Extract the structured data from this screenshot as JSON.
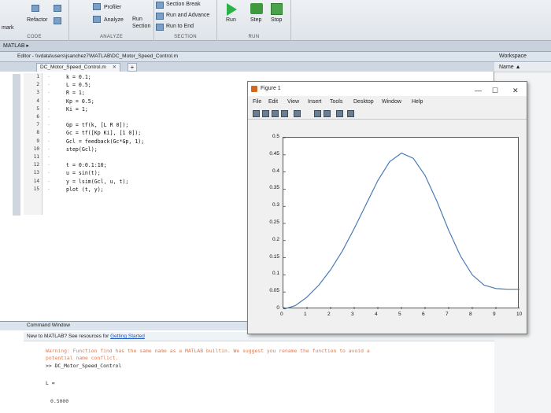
{
  "ribbon": {
    "refactor_label": "Refactor",
    "profiler_label": "Profiler",
    "analyze_label": "Analyze",
    "run_section_label": "Run\nSection",
    "section_break_label": "Section Break",
    "run_and_advance_label": "Run and Advance",
    "run_to_end_label": "Run to End",
    "run_label": "Run",
    "step_label": "Step",
    "stop_label": "Stop",
    "groups": {
      "code": "CODE",
      "analyze": "ANALYZE",
      "section": "SECTION",
      "run": "RUN"
    },
    "bookmark_label": "mark"
  },
  "matlab_bar": {
    "title": "MATLAB ▸"
  },
  "editor": {
    "title": "Editor - \\\\vdata\\users\\jsanchez7\\MATLAB\\DC_Motor_Speed_Control.m",
    "tab_label": "DC_Motor_Speed_Control.m",
    "tab_close": "✕",
    "tab_add": "+",
    "lines": [
      "k = 0.1;",
      "L = 0.5;",
      "R = 1;",
      "Kp = 0.5;",
      "Ki = 1;",
      "",
      "Gp = tf(k, [L R 0]);",
      "Gc = tf([Kp Ki], [1 0]);",
      "Gcl = feedback(Gc*Gp, 1);",
      "step(Gcl);",
      "",
      "t = 0:0.1:10;",
      "u = sin(t);",
      "y = lsim(Gcl, u, t);",
      "plot (t, y);"
    ],
    "line_numbers": [
      "1",
      "2",
      "3",
      "4",
      "5",
      "6",
      "7",
      "8",
      "9",
      "10",
      "11",
      "12",
      "13",
      "14",
      "15"
    ]
  },
  "workspace": {
    "title": "Workspace",
    "column": "Name ▲"
  },
  "command_window": {
    "title": "Command Window",
    "new_text": "New to MATLAB? See resources for ",
    "new_link": "Getting Started",
    "warning_line1": "Warning: Function find has the same name as a MATLAB builtin. We suggest you rename the function to avoid a",
    "warning_line2": "potential name conflict.",
    "prompt_line": ">> DC_Motor_Speed_Control",
    "var_line": "L =",
    "value_line": "0.5000"
  },
  "figure": {
    "title": "Figure 1",
    "menu": [
      "File",
      "Edit",
      "View",
      "Insert",
      "Tools",
      "Desktop",
      "Window",
      "Help"
    ]
  },
  "chart_data": {
    "type": "line",
    "xlim": [
      0,
      10
    ],
    "ylim": [
      0,
      0.5
    ],
    "x_ticks": [
      "0",
      "1",
      "2",
      "3",
      "4",
      "5",
      "6",
      "7",
      "8",
      "9",
      "10"
    ],
    "y_ticks": [
      "0",
      "0.05",
      "0.1",
      "0.15",
      "0.2",
      "0.25",
      "0.3",
      "0.35",
      "0.4",
      "0.45",
      "0.5"
    ],
    "x": [
      0,
      0.5,
      1,
      1.5,
      2,
      2.5,
      3,
      3.5,
      4,
      4.5,
      5,
      5.5,
      6,
      6.5,
      7,
      7.5,
      8,
      8.5,
      9,
      9.5,
      10
    ],
    "y": [
      0,
      0.01,
      0.035,
      0.07,
      0.115,
      0.17,
      0.235,
      0.305,
      0.375,
      0.43,
      0.455,
      0.44,
      0.39,
      0.315,
      0.23,
      0.155,
      0.1,
      0.07,
      0.06,
      0.058,
      0.058
    ],
    "line_color": "#4a7ab5"
  }
}
